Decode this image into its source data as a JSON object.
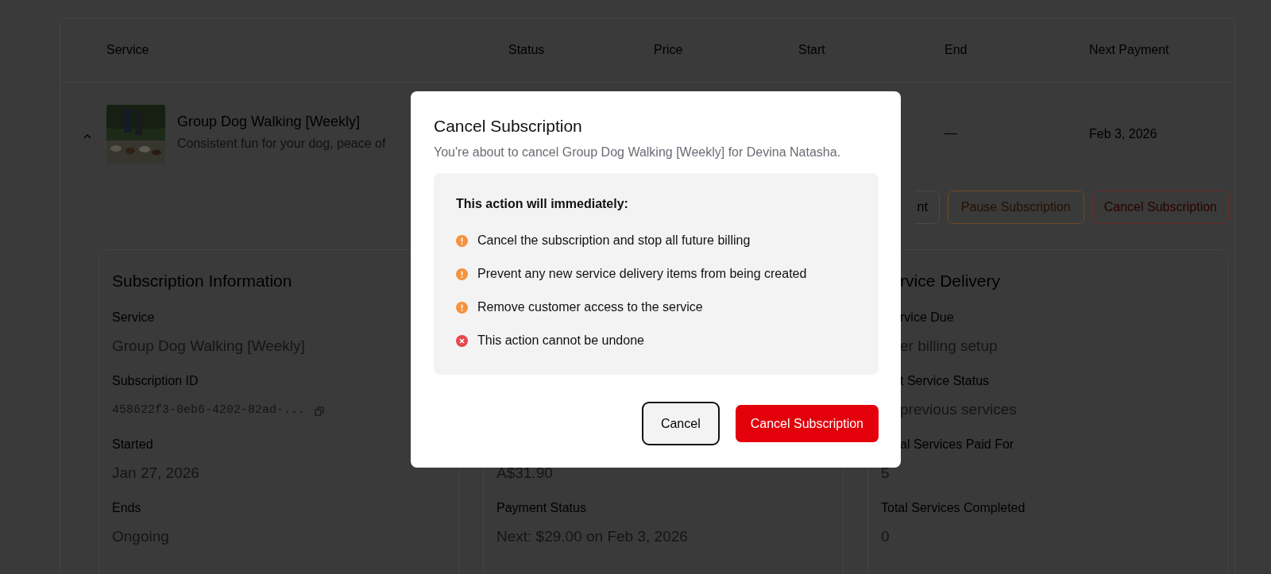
{
  "table": {
    "columns": [
      "Service",
      "Status",
      "Price",
      "Start",
      "End",
      "Next Payment"
    ],
    "row": {
      "title": "Group Dog Walking [Weekly]",
      "description": "Consistent fun for your dog, peace of",
      "end": "—",
      "next_payment": "Feb 3, 2026",
      "expanded": true
    },
    "actions": [
      {
        "label": "nt",
        "kind": "plain"
      },
      {
        "label": "Pause Subscription",
        "kind": "pause"
      },
      {
        "label": "Cancel Subscription",
        "kind": "danger"
      }
    ]
  },
  "cards": [
    {
      "items": [
        {
          "kind": "heading",
          "text": "Subscription Information"
        },
        {
          "kind": "label",
          "text": "Service"
        },
        {
          "kind": "value",
          "text": "Group Dog Walking [Weekly]"
        },
        {
          "kind": "label",
          "text": "Subscription ID"
        },
        {
          "kind": "mono",
          "text": "458622f3-0eb6-4202-82ad-..."
        },
        {
          "kind": "label",
          "text": "Started"
        },
        {
          "kind": "value",
          "text": "Jan 27, 2026"
        },
        {
          "kind": "label",
          "text": "Ends"
        },
        {
          "kind": "value",
          "text": "Ongoing"
        }
      ]
    },
    {
      "items": [
        {
          "kind": "value",
          "text": "A$31.90"
        },
        {
          "kind": "label",
          "text": "Payment Status"
        },
        {
          "kind": "value",
          "text": "Next: $29.00 on Feb 3, 2026"
        }
      ]
    },
    {
      "items": [
        {
          "kind": "heading",
          "text": "rvice Delivery"
        },
        {
          "kind": "label",
          "text": "rvice Due"
        },
        {
          "kind": "value",
          "text": "er billing setup"
        },
        {
          "kind": "label",
          "text": "t Service Status"
        },
        {
          "kind": "value",
          "text": "previous services"
        },
        {
          "kind": "label",
          "text": "al Services Paid For"
        },
        {
          "kind": "value",
          "text": "5"
        },
        {
          "kind": "label",
          "text": "Total Services Completed"
        },
        {
          "kind": "value",
          "text": "0"
        }
      ]
    }
  ],
  "dialog": {
    "title": "Cancel Subscription",
    "subtitle": "You're about to cancel Group Dog Walking [Weekly] for Devina Natasha.",
    "box_title": "This action will immediately:",
    "effects": [
      {
        "kind": "warning",
        "text": "Cancel the subscription and stop all future billing"
      },
      {
        "kind": "warning",
        "text": "Prevent any new service delivery items from being created"
      },
      {
        "kind": "warning",
        "text": "Remove customer access to the service"
      },
      {
        "kind": "error",
        "text": "This action cannot be undone"
      }
    ],
    "buttons": [
      {
        "label": "Cancel",
        "kind": "secondary"
      },
      {
        "label": "Cancel Subscription",
        "kind": "danger"
      }
    ]
  }
}
